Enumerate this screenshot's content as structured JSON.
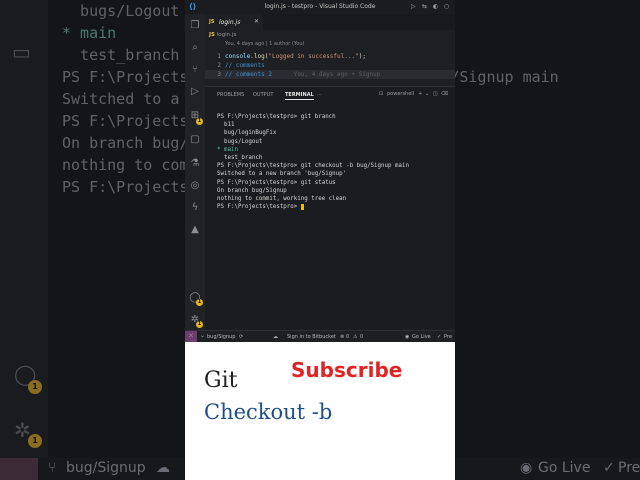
{
  "background": {
    "term_lines": [
      {
        "text": "  bugs/Logout",
        "kind": "plain"
      },
      {
        "text": "* main",
        "kind": "star"
      },
      {
        "text": "  test_branch",
        "kind": "plain"
      },
      {
        "text": "PS F:\\Projects\\testpro> git checkout -b bug/Signup main",
        "kind": "prompt"
      },
      {
        "text": "Switched to a new branch 'bug/Signup'",
        "kind": "plain"
      },
      {
        "text": "PS F:\\Projects\\testpro> git status",
        "kind": "prompt"
      },
      {
        "text": "On branch bug/Signup",
        "kind": "plain"
      },
      {
        "text": "nothing to commit, working tree clean",
        "kind": "plain"
      },
      {
        "text": "PS F:\\Projects\\testpro> ",
        "kind": "prompt"
      }
    ],
    "badge": "1",
    "status": {
      "branch": "bug/Signup",
      "golive": "Go Live",
      "pre": "Pre"
    }
  },
  "window": {
    "title": "login.js - testpro - Visual Studio Code"
  },
  "activity_bar": {
    "badge_count": "1"
  },
  "editor": {
    "tab_label": "login.js",
    "tab_icon": "JS",
    "breadcrumb": "login.js",
    "blame": "You, 4 days ago | 1 author (You)",
    "lines": [
      {
        "num": "1",
        "parts": [
          {
            "t": "console",
            "c": "c-obj"
          },
          {
            "t": ".",
            "c": ""
          },
          {
            "t": "log",
            "c": "c-fn"
          },
          {
            "t": "(",
            "c": ""
          },
          {
            "t": "\"Logged in successful...\"",
            "c": "c-str"
          },
          {
            "t": ");",
            "c": ""
          }
        ]
      },
      {
        "num": "2",
        "parts": [
          {
            "t": "// comments",
            "c": "c-com"
          }
        ]
      },
      {
        "num": "3",
        "parts": [
          {
            "t": "// comments 2",
            "c": "c-com"
          },
          {
            "t": "      You, 4 days ago • Signup",
            "c": "c-ghost"
          }
        ]
      }
    ]
  },
  "panel": {
    "tabs": [
      "PROBLEMS",
      "OUTPUT",
      "TERMINAL",
      "···"
    ],
    "active_tab": "TERMINAL",
    "shell_label": "powershell",
    "terminal": [
      "PS F:\\Projects\\testpro> git branch",
      "  b11",
      "  bug/loginBugFix",
      "  bugs/Logout",
      "* main",
      "  test_branch",
      "PS F:\\Projects\\testpro> git checkout -b bug/Signup main",
      "Switched to a new branch 'bug/Signup'",
      "PS F:\\Projects\\testpro> git status",
      "On branch bug/Signup",
      "nothing to commit, working tree clean",
      "PS F:\\Projects\\testpro> "
    ]
  },
  "status_bar": {
    "branch": "bug/Signup",
    "bitbucket": "Sign in to Bitbucket",
    "errors": "0",
    "warnings": "0",
    "golive": "Go Live",
    "prettier": "Pre"
  },
  "caption": {
    "subscribe": "Subscribe",
    "line1": "Git",
    "line2": "Checkout -b"
  },
  "colors": {
    "subscribe": "#e02424",
    "checkout_text": "#1f4e8c",
    "accent_badge": "#e4b51f",
    "remote": "#6c3d6c"
  }
}
